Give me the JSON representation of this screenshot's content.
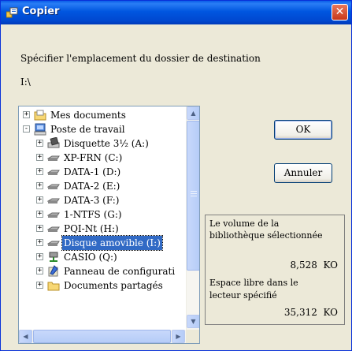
{
  "dialog": {
    "title": "Copier",
    "close_glyph": "✕",
    "instruction": "Spécifier l'emplacement du dossier de destination",
    "path": "I:\\"
  },
  "tree": {
    "items": [
      {
        "label": "Mes documents",
        "icon": "my-documents-icon",
        "expander": "+"
      },
      {
        "label": "Poste de travail",
        "icon": "my-computer-icon",
        "expander": "-"
      },
      {
        "label": "Disquette 3½ (A:)",
        "icon": "floppy-drive-icon",
        "expander": "+"
      },
      {
        "label": "XP-FRN (C:)",
        "icon": "hard-drive-icon",
        "expander": "+"
      },
      {
        "label": "DATA-1 (D:)",
        "icon": "hard-drive-icon",
        "expander": "+"
      },
      {
        "label": "DATA-2 (E:)",
        "icon": "hard-drive-icon",
        "expander": "+"
      },
      {
        "label": "DATA-3 (F:)",
        "icon": "hard-drive-icon",
        "expander": "+"
      },
      {
        "label": "1-NTFS (G:)",
        "icon": "hard-drive-icon",
        "expander": "+"
      },
      {
        "label": "PQI-Nt (H:)",
        "icon": "hard-drive-icon",
        "expander": "+"
      },
      {
        "label": "Disque amovible (I:)",
        "icon": "removable-drive-icon",
        "expander": "+",
        "selected": true
      },
      {
        "label": "CASIO (Q:)",
        "icon": "network-drive-icon",
        "expander": "+"
      },
      {
        "label": "Panneau de configurati",
        "icon": "control-panel-icon",
        "expander": "+"
      },
      {
        "label": "Documents partagés",
        "icon": "shared-folder-icon",
        "expander": "+"
      }
    ]
  },
  "buttons": {
    "ok": "OK",
    "cancel": "Annuler"
  },
  "info": {
    "library_size_label_1": "Le volume de la",
    "library_size_label_2": "bibliothèque sélectionnée",
    "library_size_value": "8,528  KO",
    "free_space_label_1": "Espace libre dans le",
    "free_space_label_2": "lecteur spécifié",
    "free_space_value": "35,312  KO"
  },
  "colors": {
    "titlebar": "#0054e3",
    "selection": "#316ac5",
    "close": "#d84a24"
  }
}
